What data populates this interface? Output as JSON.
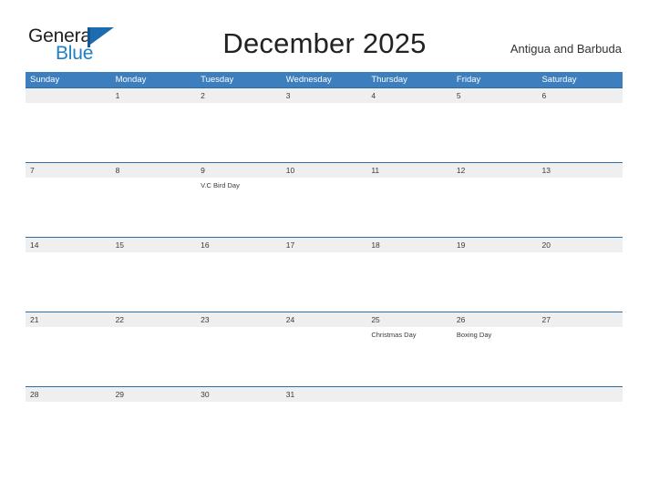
{
  "brand": {
    "name_part1": "General",
    "name_part2": "Blue",
    "flag_icon": "flag-triangle-icon"
  },
  "header": {
    "title": "December 2025",
    "subtitle": "Antigua and Barbuda"
  },
  "colors": {
    "header_blue": "#3d7ebe",
    "rule_blue": "#2e6da4",
    "number_band": "#efefef",
    "brand_blue": "#1e7fc4",
    "text_dark": "#3a3a3a"
  },
  "calendar": {
    "weekdays": [
      "Sunday",
      "Monday",
      "Tuesday",
      "Wednesday",
      "Thursday",
      "Friday",
      "Saturday"
    ],
    "weeks": [
      {
        "days": [
          {
            "number": "",
            "events": []
          },
          {
            "number": "1",
            "events": []
          },
          {
            "number": "2",
            "events": []
          },
          {
            "number": "3",
            "events": []
          },
          {
            "number": "4",
            "events": []
          },
          {
            "number": "5",
            "events": []
          },
          {
            "number": "6",
            "events": []
          }
        ]
      },
      {
        "days": [
          {
            "number": "7",
            "events": []
          },
          {
            "number": "8",
            "events": []
          },
          {
            "number": "9",
            "events": [
              "V.C Bird Day"
            ]
          },
          {
            "number": "10",
            "events": []
          },
          {
            "number": "11",
            "events": []
          },
          {
            "number": "12",
            "events": []
          },
          {
            "number": "13",
            "events": []
          }
        ]
      },
      {
        "days": [
          {
            "number": "14",
            "events": []
          },
          {
            "number": "15",
            "events": []
          },
          {
            "number": "16",
            "events": []
          },
          {
            "number": "17",
            "events": []
          },
          {
            "number": "18",
            "events": []
          },
          {
            "number": "19",
            "events": []
          },
          {
            "number": "20",
            "events": []
          }
        ]
      },
      {
        "days": [
          {
            "number": "21",
            "events": []
          },
          {
            "number": "22",
            "events": []
          },
          {
            "number": "23",
            "events": []
          },
          {
            "number": "24",
            "events": []
          },
          {
            "number": "25",
            "events": [
              "Christmas Day"
            ]
          },
          {
            "number": "26",
            "events": [
              "Boxing Day"
            ]
          },
          {
            "number": "27",
            "events": []
          }
        ]
      },
      {
        "days": [
          {
            "number": "28",
            "events": []
          },
          {
            "number": "29",
            "events": []
          },
          {
            "number": "30",
            "events": []
          },
          {
            "number": "31",
            "events": []
          },
          {
            "number": "",
            "events": []
          },
          {
            "number": "",
            "events": []
          },
          {
            "number": "",
            "events": []
          }
        ]
      }
    ]
  }
}
